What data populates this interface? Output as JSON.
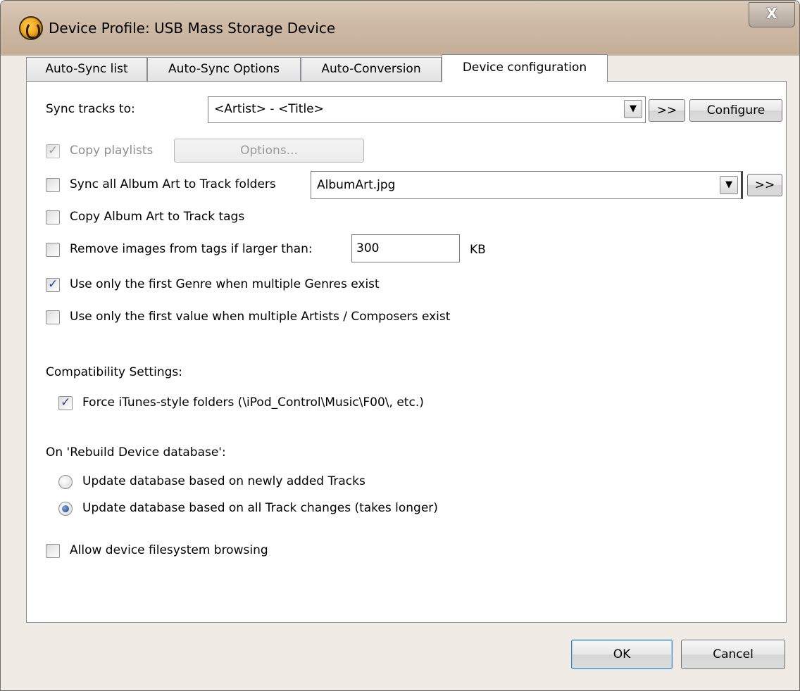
{
  "window": {
    "title": "Device Profile: USB Mass Storage Device",
    "close_label": "X"
  },
  "tabs": [
    {
      "label": "Auto-Sync list",
      "active": false
    },
    {
      "label": "Auto-Sync Options",
      "active": false
    },
    {
      "label": "Auto-Conversion",
      "active": false
    },
    {
      "label": "Device configuration",
      "active": true
    }
  ],
  "sync_tracks": {
    "label": "Sync tracks to:",
    "value": "<Artist> - <Title>",
    "arrow_button": ">>",
    "configure_button": "Configure"
  },
  "copy_playlists": {
    "label": "Copy playlists",
    "checked": true,
    "disabled": true,
    "options_button": "Options..."
  },
  "album_art_folders": {
    "label": "Sync all Album Art to Track folders",
    "checked": false,
    "value": "AlbumArt.jpg",
    "arrow_button": ">>"
  },
  "album_art_tags": {
    "label": "Copy Album Art to Track tags",
    "checked": false
  },
  "remove_images": {
    "label": "Remove images from tags if larger than:",
    "checked": false,
    "value": "300",
    "unit": "KB"
  },
  "first_genre": {
    "label": "Use only the first Genre when multiple Genres exist",
    "checked": true
  },
  "first_artist": {
    "label": "Use only the first value when multiple Artists / Composers exist",
    "checked": false
  },
  "compatibility": {
    "heading": "Compatibility Settings:",
    "itunes_folders": {
      "label": "Force iTunes-style folders (\\iPod_Control\\Music\\F00\\, etc.)",
      "checked": true
    }
  },
  "rebuild": {
    "heading": "On 'Rebuild Device database':",
    "options": [
      {
        "label": "Update database based on newly added Tracks",
        "selected": false
      },
      {
        "label": "Update database based on all Track changes (takes longer)",
        "selected": true
      }
    ]
  },
  "filesystem_browsing": {
    "label": "Allow device filesystem browsing",
    "checked": false
  },
  "footer": {
    "ok_label": "OK",
    "cancel_label": "Cancel"
  },
  "icons": {
    "app": "mediamonkey-icon",
    "dropdown": "chevron-down-icon",
    "check": "check-icon"
  }
}
